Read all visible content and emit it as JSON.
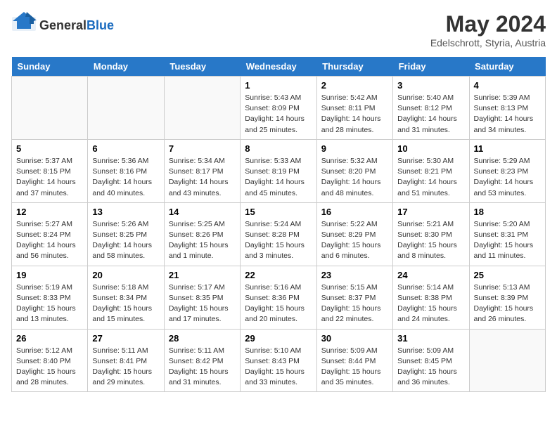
{
  "header": {
    "logo_general": "General",
    "logo_blue": "Blue",
    "month_year": "May 2024",
    "location": "Edelschrott, Styria, Austria"
  },
  "days_of_week": [
    "Sunday",
    "Monday",
    "Tuesday",
    "Wednesday",
    "Thursday",
    "Friday",
    "Saturday"
  ],
  "weeks": [
    [
      {
        "day": "",
        "info": ""
      },
      {
        "day": "",
        "info": ""
      },
      {
        "day": "",
        "info": ""
      },
      {
        "day": "1",
        "info": "Sunrise: 5:43 AM\nSunset: 8:09 PM\nDaylight: 14 hours and 25 minutes."
      },
      {
        "day": "2",
        "info": "Sunrise: 5:42 AM\nSunset: 8:11 PM\nDaylight: 14 hours and 28 minutes."
      },
      {
        "day": "3",
        "info": "Sunrise: 5:40 AM\nSunset: 8:12 PM\nDaylight: 14 hours and 31 minutes."
      },
      {
        "day": "4",
        "info": "Sunrise: 5:39 AM\nSunset: 8:13 PM\nDaylight: 14 hours and 34 minutes."
      }
    ],
    [
      {
        "day": "5",
        "info": "Sunrise: 5:37 AM\nSunset: 8:15 PM\nDaylight: 14 hours and 37 minutes."
      },
      {
        "day": "6",
        "info": "Sunrise: 5:36 AM\nSunset: 8:16 PM\nDaylight: 14 hours and 40 minutes."
      },
      {
        "day": "7",
        "info": "Sunrise: 5:34 AM\nSunset: 8:17 PM\nDaylight: 14 hours and 43 minutes."
      },
      {
        "day": "8",
        "info": "Sunrise: 5:33 AM\nSunset: 8:19 PM\nDaylight: 14 hours and 45 minutes."
      },
      {
        "day": "9",
        "info": "Sunrise: 5:32 AM\nSunset: 8:20 PM\nDaylight: 14 hours and 48 minutes."
      },
      {
        "day": "10",
        "info": "Sunrise: 5:30 AM\nSunset: 8:21 PM\nDaylight: 14 hours and 51 minutes."
      },
      {
        "day": "11",
        "info": "Sunrise: 5:29 AM\nSunset: 8:23 PM\nDaylight: 14 hours and 53 minutes."
      }
    ],
    [
      {
        "day": "12",
        "info": "Sunrise: 5:27 AM\nSunset: 8:24 PM\nDaylight: 14 hours and 56 minutes."
      },
      {
        "day": "13",
        "info": "Sunrise: 5:26 AM\nSunset: 8:25 PM\nDaylight: 14 hours and 58 minutes."
      },
      {
        "day": "14",
        "info": "Sunrise: 5:25 AM\nSunset: 8:26 PM\nDaylight: 15 hours and 1 minute."
      },
      {
        "day": "15",
        "info": "Sunrise: 5:24 AM\nSunset: 8:28 PM\nDaylight: 15 hours and 3 minutes."
      },
      {
        "day": "16",
        "info": "Sunrise: 5:22 AM\nSunset: 8:29 PM\nDaylight: 15 hours and 6 minutes."
      },
      {
        "day": "17",
        "info": "Sunrise: 5:21 AM\nSunset: 8:30 PM\nDaylight: 15 hours and 8 minutes."
      },
      {
        "day": "18",
        "info": "Sunrise: 5:20 AM\nSunset: 8:31 PM\nDaylight: 15 hours and 11 minutes."
      }
    ],
    [
      {
        "day": "19",
        "info": "Sunrise: 5:19 AM\nSunset: 8:33 PM\nDaylight: 15 hours and 13 minutes."
      },
      {
        "day": "20",
        "info": "Sunrise: 5:18 AM\nSunset: 8:34 PM\nDaylight: 15 hours and 15 minutes."
      },
      {
        "day": "21",
        "info": "Sunrise: 5:17 AM\nSunset: 8:35 PM\nDaylight: 15 hours and 17 minutes."
      },
      {
        "day": "22",
        "info": "Sunrise: 5:16 AM\nSunset: 8:36 PM\nDaylight: 15 hours and 20 minutes."
      },
      {
        "day": "23",
        "info": "Sunrise: 5:15 AM\nSunset: 8:37 PM\nDaylight: 15 hours and 22 minutes."
      },
      {
        "day": "24",
        "info": "Sunrise: 5:14 AM\nSunset: 8:38 PM\nDaylight: 15 hours and 24 minutes."
      },
      {
        "day": "25",
        "info": "Sunrise: 5:13 AM\nSunset: 8:39 PM\nDaylight: 15 hours and 26 minutes."
      }
    ],
    [
      {
        "day": "26",
        "info": "Sunrise: 5:12 AM\nSunset: 8:40 PM\nDaylight: 15 hours and 28 minutes."
      },
      {
        "day": "27",
        "info": "Sunrise: 5:11 AM\nSunset: 8:41 PM\nDaylight: 15 hours and 29 minutes."
      },
      {
        "day": "28",
        "info": "Sunrise: 5:11 AM\nSunset: 8:42 PM\nDaylight: 15 hours and 31 minutes."
      },
      {
        "day": "29",
        "info": "Sunrise: 5:10 AM\nSunset: 8:43 PM\nDaylight: 15 hours and 33 minutes."
      },
      {
        "day": "30",
        "info": "Sunrise: 5:09 AM\nSunset: 8:44 PM\nDaylight: 15 hours and 35 minutes."
      },
      {
        "day": "31",
        "info": "Sunrise: 5:09 AM\nSunset: 8:45 PM\nDaylight: 15 hours and 36 minutes."
      },
      {
        "day": "",
        "info": ""
      }
    ]
  ]
}
